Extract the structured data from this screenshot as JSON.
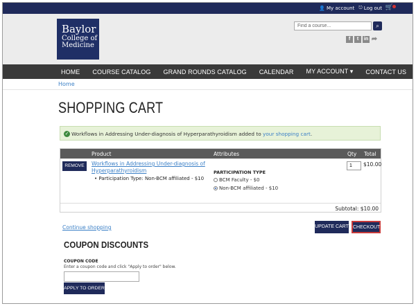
{
  "topbar": {
    "my_account": "My account",
    "logout": "Log out"
  },
  "header": {
    "logo_line1": "Baylor",
    "logo_line2": "College of",
    "logo_line3": "Medicine",
    "search_placeholder": "Find a course..."
  },
  "nav": {
    "items": [
      "HOME",
      "COURSE CATALOG",
      "GRAND ROUNDS CATALOG",
      "CALENDAR",
      "MY ACCOUNT ▾",
      "CONTACT US"
    ]
  },
  "breadcrumb": "Home",
  "page_title": "SHOPPING CART",
  "alert": {
    "text": "Workflows in Addressing Under-diagnosis of Hyperparathyroidism added to ",
    "link": "your shopping cart",
    "end": "."
  },
  "table": {
    "headers": {
      "product": "Product",
      "attributes": "Attributes",
      "qty": "Qty",
      "total": "Total"
    },
    "remove_label": "REMOVE",
    "product_name": "Workflows in Addressing Under-diagnosis of Hyperparathyroidism",
    "product_attr": "• Participation Type: Non-BCM affiliated - $10",
    "attr_heading": "PARTICIPATION TYPE",
    "options": [
      {
        "label": "BCM Faculty - $0",
        "selected": false
      },
      {
        "label": "Non-BCM affiliated - $10",
        "selected": true
      }
    ],
    "qty": "1",
    "line_total": "$10.00",
    "subtotal": "Subtotal: $10.00"
  },
  "actions": {
    "continue": "Continue shopping",
    "update": "UPDATE CART",
    "checkout": "CHECKOUT"
  },
  "coupon": {
    "title": "COUPON DISCOUNTS",
    "label": "COUPON CODE",
    "help": "Enter a coupon code and click \"Apply to order\" below.",
    "value": "",
    "apply": "APPLY TO ORDER"
  },
  "colors": {
    "navy": "#1f2a5a",
    "link": "#3a7fc6",
    "highlight": "#c83a3a"
  }
}
